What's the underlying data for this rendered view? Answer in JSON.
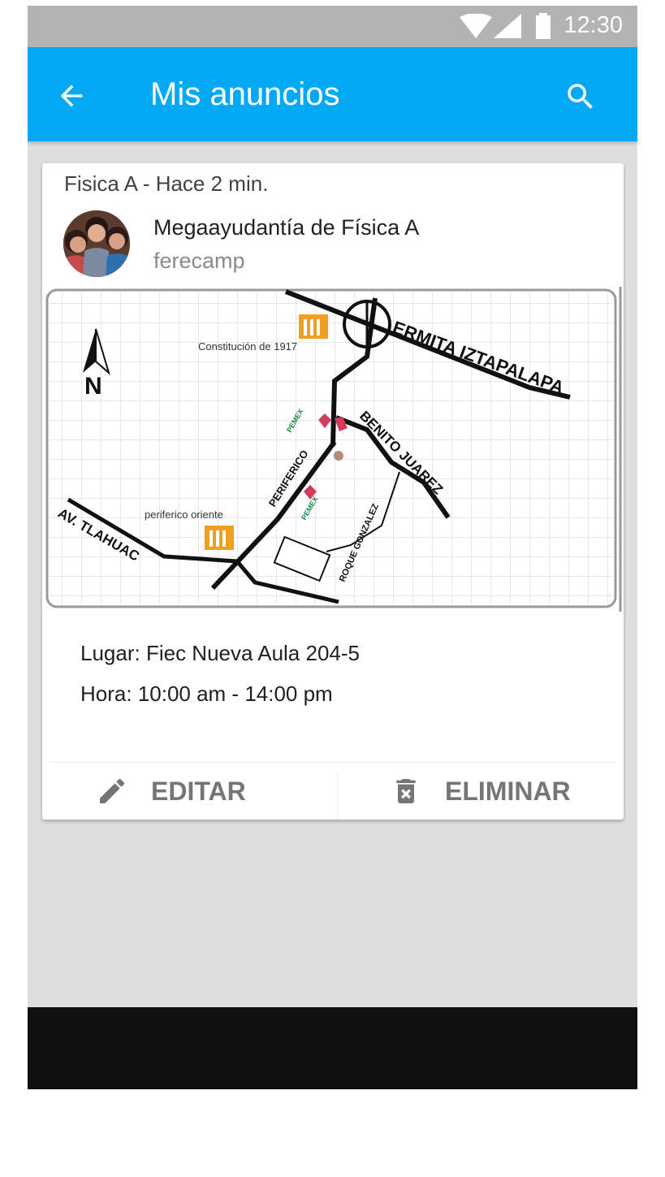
{
  "status_bar": {
    "time": "12:30"
  },
  "app_bar": {
    "title": "Mis anuncios"
  },
  "post": {
    "meta": "Fisica A - Hace 2 min.",
    "title": "Megaayudantía de Física A",
    "author": "ferecamp",
    "map_labels": {
      "metro_top": "Constitución de 1917",
      "street_ermita": "ERMITA IZTAPALAPA",
      "street_benito": "BENITO JUAREZ",
      "street_periferico": "PERIFERICO",
      "street_tlahuac": "AV. TLAHUAC",
      "metro_bottom": "periferico oriente",
      "street_roque": "ROQUE GONZALEZ",
      "pemex_top": "PEMEX",
      "pemex_bottom": "PEMEX",
      "north": "N"
    },
    "lugar": "Lugar: Fiec Nueva Aula 204-5",
    "hora": "Hora: 10:00 am - 14:00 pm",
    "edit_label": "EDITAR",
    "delete_label": "ELIMINAR"
  },
  "colors": {
    "app_bar": "#03a9f4",
    "status_bar": "#b3b3b3",
    "background": "#dedede"
  }
}
